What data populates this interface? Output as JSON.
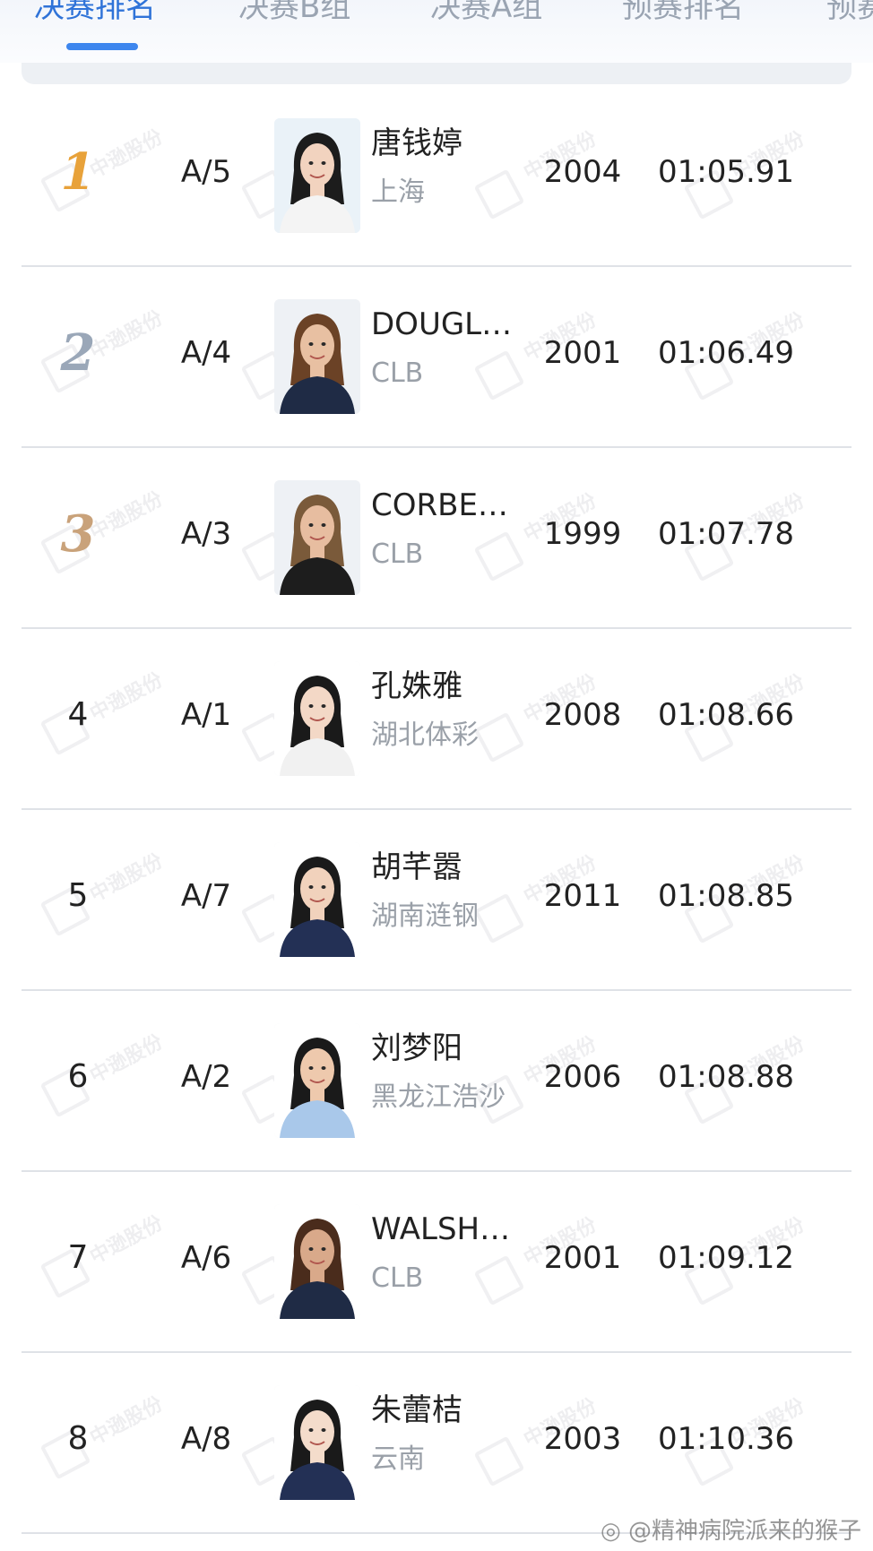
{
  "tabs": [
    {
      "label": "决赛排名",
      "active": true
    },
    {
      "label": "决赛B组",
      "active": false
    },
    {
      "label": "决赛A组",
      "active": false
    },
    {
      "label": "预赛排名",
      "active": false
    },
    {
      "label": "预赛",
      "active": false
    }
  ],
  "colors": {
    "accent": "#3d86ee",
    "gold": "#e8a23a",
    "silver": "#9aa7b8",
    "bronze": "#c9a27a"
  },
  "watermark": {
    "text": "中逊股份",
    "icon": "dp-logo-icon"
  },
  "results": [
    {
      "rank": "1",
      "medal": "gold",
      "lane": "A/5",
      "name": "唐钱婷",
      "team": "上海",
      "year": "2004",
      "time": "01:05.91",
      "photo": "athlete-photo"
    },
    {
      "rank": "2",
      "medal": "silver",
      "lane": "A/4",
      "name": "DOUGL…",
      "team": "CLB",
      "year": "2001",
      "time": "01:06.49",
      "photo": "athlete-photo"
    },
    {
      "rank": "3",
      "medal": "bronze",
      "lane": "A/3",
      "name": "CORBE…",
      "team": "CLB",
      "year": "1999",
      "time": "01:07.78",
      "photo": "athlete-photo"
    },
    {
      "rank": "4",
      "medal": "",
      "lane": "A/1",
      "name": "孔姝雅",
      "team": "湖北体彩",
      "year": "2008",
      "time": "01:08.66",
      "photo": "athlete-photo"
    },
    {
      "rank": "5",
      "medal": "",
      "lane": "A/7",
      "name": "胡芊嚣",
      "team": "湖南涟钢",
      "year": "2011",
      "time": "01:08.85",
      "photo": "athlete-photo"
    },
    {
      "rank": "6",
      "medal": "",
      "lane": "A/2",
      "name": "刘梦阳",
      "team": "黑龙江浩沙",
      "year": "2006",
      "time": "01:08.88",
      "photo": "athlete-photo"
    },
    {
      "rank": "7",
      "medal": "",
      "lane": "A/6",
      "name": "WALSH…",
      "team": "CLB",
      "year": "2001",
      "time": "01:09.12",
      "photo": "athlete-photo"
    },
    {
      "rank": "8",
      "medal": "",
      "lane": "A/8",
      "name": "朱蕾桔",
      "team": "云南",
      "year": "2003",
      "time": "01:10.36",
      "photo": "athlete-photo"
    }
  ],
  "footer": {
    "weibo_handle": "@精神病院派来的猴子"
  }
}
